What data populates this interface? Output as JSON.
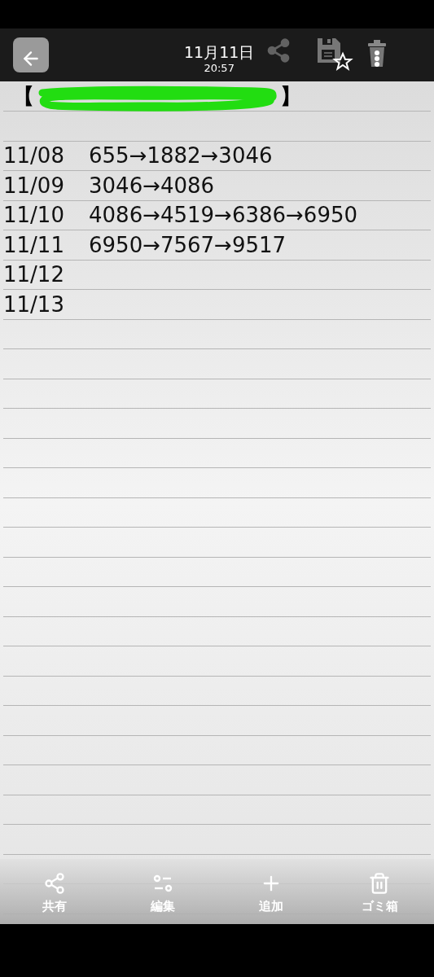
{
  "header": {
    "title": "11月11日",
    "time": "20:57",
    "share_disabled": true
  },
  "note": {
    "title_open": "【",
    "title_close": "】",
    "redacted": true,
    "entries": [
      {
        "date": "11/08",
        "value": "655→1882→3046"
      },
      {
        "date": "11/09",
        "value": "3046→4086"
      },
      {
        "date": "11/10",
        "value": "4086→4519→6386→6950"
      },
      {
        "date": "11/11",
        "value": "6950→7567→9517"
      },
      {
        "date": "11/12"
      },
      {
        "date": "11/13"
      }
    ]
  },
  "toolbar": [
    {
      "kind": "share",
      "label": "共有"
    },
    {
      "kind": "edit",
      "label": "編集"
    },
    {
      "kind": "add",
      "label": "追加"
    },
    {
      "kind": "trash",
      "label": "ゴミ箱"
    }
  ]
}
